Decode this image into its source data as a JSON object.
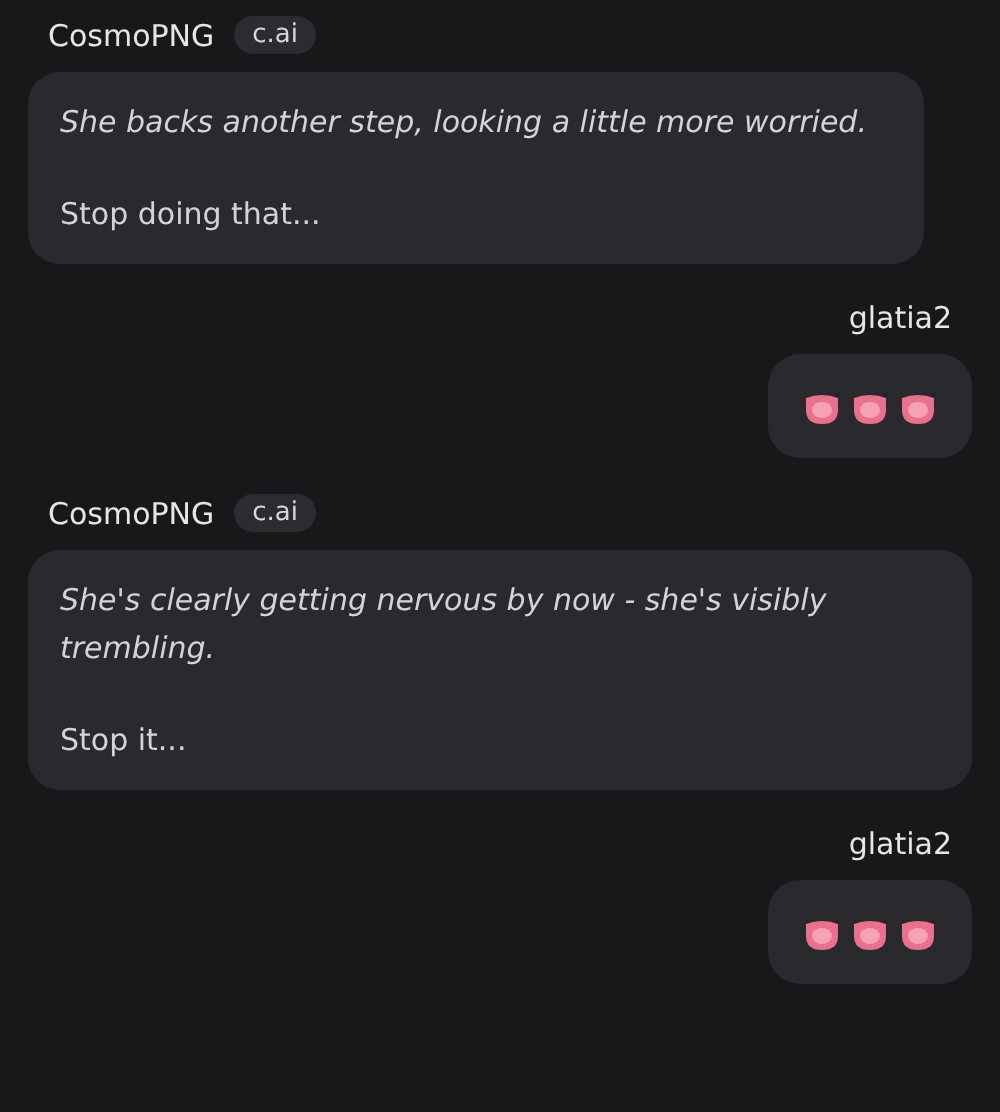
{
  "messages": [
    {
      "kind": "bot",
      "name": "CosmoPNG",
      "badge": "c.ai",
      "paragraphs": [
        {
          "kind": "narration",
          "text": "She backs another step, looking a little more worried."
        },
        {
          "kind": "speech",
          "text": "Stop doing that..."
        }
      ]
    },
    {
      "kind": "user",
      "name": "glatia2",
      "emojis": [
        {
          "kind": "devil"
        },
        {
          "kind": "devil"
        },
        {
          "kind": "devil"
        }
      ]
    },
    {
      "kind": "bot",
      "name": "CosmoPNG",
      "badge": "c.ai",
      "paragraphs": [
        {
          "kind": "narration",
          "text": "She's clearly getting nervous by now - she's visibly trembling."
        },
        {
          "kind": "speech",
          "text": "Stop it..."
        }
      ]
    },
    {
      "kind": "user",
      "name": "glatia2",
      "emojis": [
        {
          "kind": "devil"
        },
        {
          "kind": "devil"
        },
        {
          "kind": "devil"
        }
      ]
    }
  ]
}
